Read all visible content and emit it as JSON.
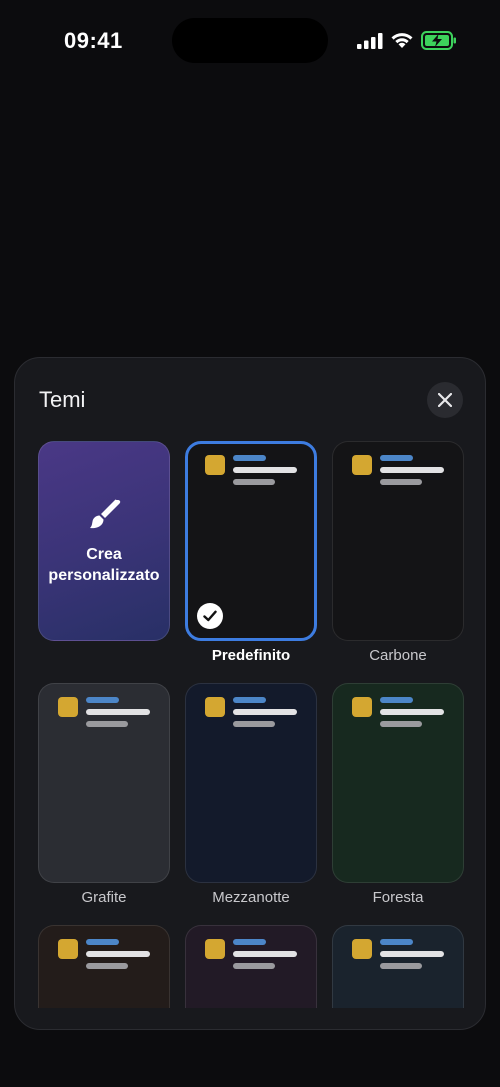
{
  "status_bar": {
    "time": "09:41",
    "icons": [
      "signal-icon",
      "wifi-icon",
      "battery-charging-icon"
    ]
  },
  "sheet": {
    "title": "Temi",
    "close_icon": "close-icon"
  },
  "themes": [
    {
      "id": "custom",
      "label": "Crea personalizzato",
      "label_line1": "Crea",
      "label_line2": "personalizzato",
      "icon": "paintbrush-icon",
      "colors": [
        "#4a3886",
        "#283066"
      ]
    },
    {
      "id": "predefinito",
      "label": "Predefinito",
      "selected": true,
      "background": "#141416"
    },
    {
      "id": "carbone",
      "label": "Carbone",
      "selected": false,
      "background": "#141416"
    },
    {
      "id": "grafite",
      "label": "Grafite",
      "selected": false,
      "background": "#2b2d33"
    },
    {
      "id": "mezzanotte",
      "label": "Mezzanotte",
      "selected": false,
      "background": "#131a2b"
    },
    {
      "id": "foresta",
      "label": "Foresta",
      "selected": false,
      "background": "#17291f"
    },
    {
      "id": "theme-7",
      "label": "",
      "selected": false,
      "background": "#231c1a"
    },
    {
      "id": "theme-8",
      "label": "",
      "selected": false,
      "background": "#221a26"
    },
    {
      "id": "theme-9",
      "label": "",
      "selected": false,
      "background": "#1a232d"
    }
  ],
  "colors": {
    "accent": "#3d7ce0",
    "preview_square": "#d4a731",
    "preview_line_blue": "#4c86c8",
    "battery": "#3dd35c"
  }
}
